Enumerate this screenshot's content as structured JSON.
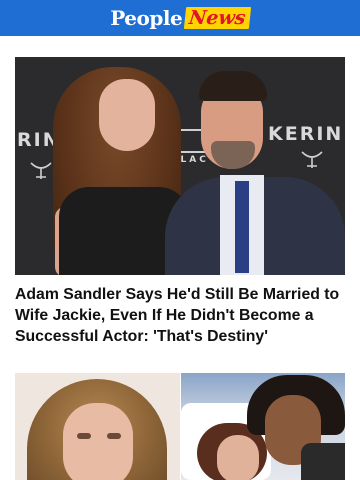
{
  "header": {
    "logo_people": "People",
    "logo_news": "News",
    "background_color": "#1f6ed4",
    "news_badge_color": "#ffd400",
    "news_text_color": "#e3132a"
  },
  "hero": {
    "image_subject": "Adam Sandler and Jackie Sandler on red carpet",
    "backdrop_text_left": "RIN",
    "backdrop_text_right": "KERIN",
    "backdrop_text_center": "DILLAC"
  },
  "article": {
    "headline": "Adam Sandler Says He'd Still Be Married to Wife Jackie, Even If He Didn't Become a Successful Actor: 'That's Destiny'"
  },
  "thumbnails": [
    {
      "subject": "woman with curly hair selfie"
    },
    {
      "subject": "couple in hospital bed"
    }
  ]
}
